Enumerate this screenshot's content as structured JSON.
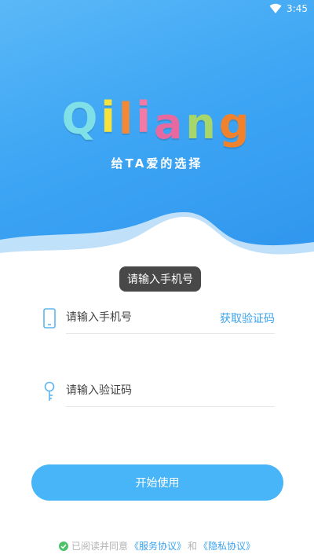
{
  "status_bar": {
    "time": "3:45"
  },
  "header": {
    "logo_letters": [
      {
        "char": "Q",
        "color": "#7fe0e8"
      },
      {
        "char": "i",
        "color": "#f6e23c"
      },
      {
        "char": "l",
        "color": "#f08a3a"
      },
      {
        "char": "i",
        "color": "#f27aa4"
      },
      {
        "char": "a",
        "color": "#e66aa0"
      },
      {
        "char": "n",
        "color": "#a7d66a"
      },
      {
        "char": "g",
        "color": "#f0822e"
      }
    ],
    "slogan": "给TA爱的选择"
  },
  "toast": "请输入手机号",
  "phone": {
    "placeholder": "请输入手机号",
    "value": "",
    "get_code_label": "获取验证码"
  },
  "code": {
    "placeholder": "请输入验证码",
    "value": ""
  },
  "start_button": "开始使用",
  "agreement": {
    "prefix": "已阅读并同意",
    "service": "《服务协议》",
    "and": "和",
    "privacy": "《隐私协议》"
  },
  "colors": {
    "accent": "#3aa3ee",
    "button": "#47b5f7",
    "header": "#3ea6f4"
  }
}
